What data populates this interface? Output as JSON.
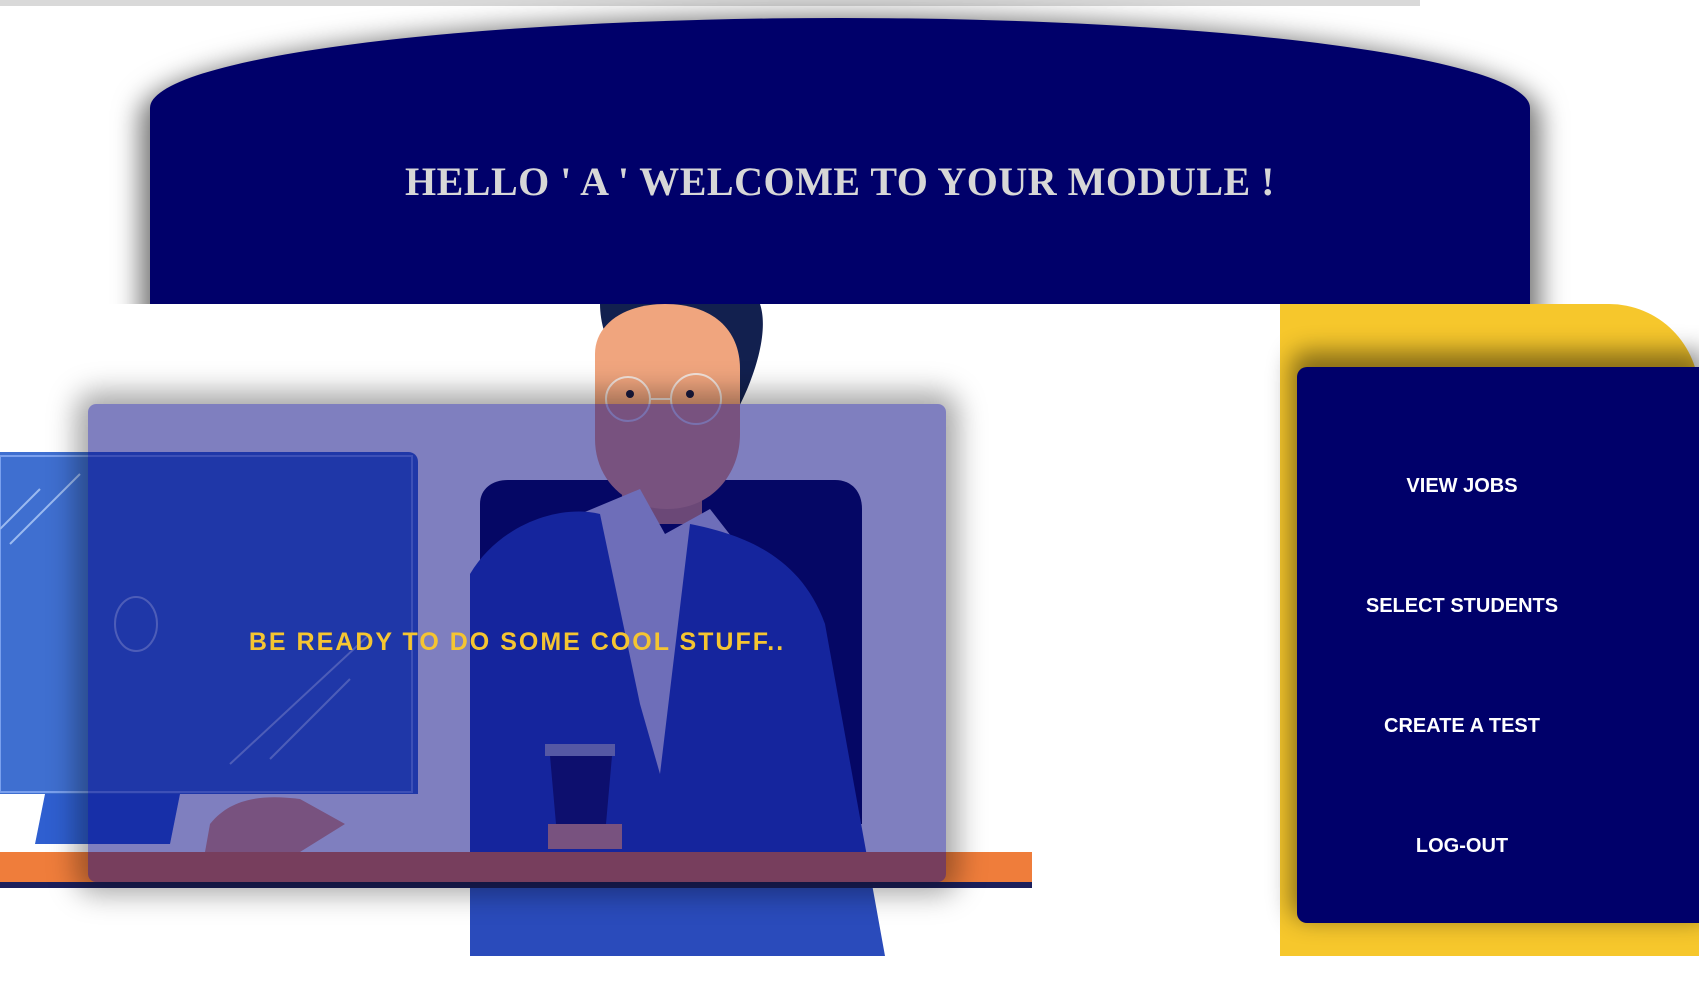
{
  "header": {
    "title": "HELLO ' A ' WELCOME TO YOUR MODULE !"
  },
  "hero": {
    "tagline": "BE READY TO DO SOME COOL STUFF.."
  },
  "menu": {
    "items": [
      {
        "label": "VIEW JOBS"
      },
      {
        "label": "SELECT STUDENTS"
      },
      {
        "label": "CREATE A TEST"
      },
      {
        "label": "LOG-OUT"
      }
    ]
  },
  "colors": {
    "navy": "#00006a",
    "accent_yellow": "#f6c72c",
    "tagline_yellow": "#f5c531",
    "title_gray": "#d7d7d7"
  },
  "icons": [
    "person-at-desk-illustration"
  ]
}
